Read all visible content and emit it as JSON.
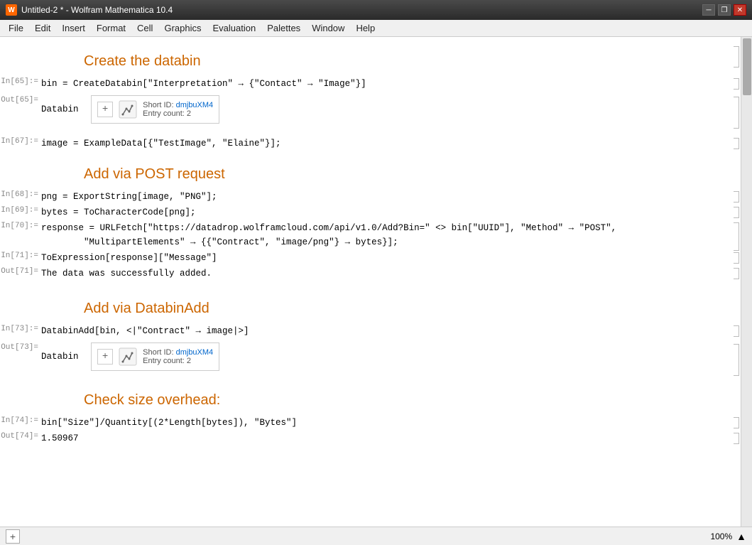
{
  "window": {
    "title": "Untitled-2 * - Wolfram Mathematica 10.4",
    "icon_label": "W"
  },
  "menu": {
    "items": [
      "File",
      "Edit",
      "Insert",
      "Format",
      "Cell",
      "Graphics",
      "Evaluation",
      "Palettes",
      "Window",
      "Help"
    ]
  },
  "sections": [
    {
      "id": "s1",
      "header": "Create the databin",
      "cells": [
        {
          "type": "input",
          "label": "In[65]:=",
          "code": "bin = CreateDatabin[\"Interpretation\" → {\"Contact\" → \"Image\"}]"
        },
        {
          "type": "output_widget",
          "label": "Out[65]=",
          "prefix": "Databin",
          "short_id": "dmjbuXM4",
          "entry_count": "2"
        }
      ]
    },
    {
      "id": "s2",
      "cells": [
        {
          "type": "input",
          "label": "In[67]:=",
          "code": "image = ExampleData[{\"TestImage\", \"Elaine\"}];"
        }
      ]
    },
    {
      "id": "s3",
      "header": "Add via POST request",
      "cells": [
        {
          "type": "input",
          "label": "In[68]:=",
          "code": "png = ExportString[image, \"PNG\"];"
        },
        {
          "type": "input",
          "label": "In[69]:=",
          "code": "bytes = ToCharacterCode[png];"
        },
        {
          "type": "input",
          "label": "In[70]:=",
          "code": "response = URLFetch[\"https://datadrop.wolframcloud.com/api/v1.0/Add?Bin=\" <> bin[\"UUID\"], \"Method\" → \"POST\",\n        \"MultipartElements\" → {{\"Contract\", \"image/png\"} → bytes}];"
        },
        {
          "type": "input",
          "label": "In[71]:=",
          "code": "ToExpression[response][\"Message\"]"
        },
        {
          "type": "output",
          "label": "Out[71]=",
          "value": "The data was successfully added."
        }
      ]
    },
    {
      "id": "s4",
      "header": "Add via DatabinAdd",
      "cells": [
        {
          "type": "input",
          "label": "In[73]:=",
          "code": "DatabinAdd[bin, <|\"Contract\" → image|>]"
        },
        {
          "type": "output_widget",
          "label": "Out[73]=",
          "prefix": "Databin",
          "short_id": "dmjbuXM4",
          "entry_count": "2"
        }
      ]
    },
    {
      "id": "s5",
      "header": "Check size overhead:",
      "cells": [
        {
          "type": "input",
          "label": "In[74]:=",
          "code": "bin[\"Size\"]/Quantity[(2*Length[bytes]), \"Bytes\"]"
        },
        {
          "type": "output",
          "label": "Out[74]=",
          "value": "1.50967"
        }
      ]
    }
  ],
  "status": {
    "zoom": "100%",
    "add_button": "+"
  }
}
